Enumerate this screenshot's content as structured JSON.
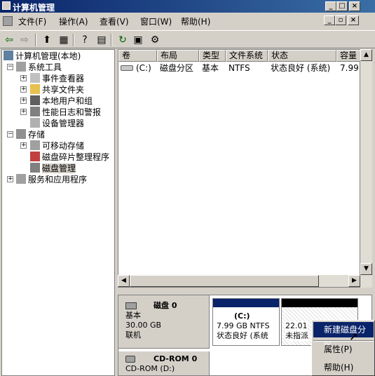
{
  "window": {
    "title": "计算机管理"
  },
  "menu": [
    {
      "label": "文件(F)"
    },
    {
      "label": "操作(A)"
    },
    {
      "label": "查看(V)"
    },
    {
      "label": "窗口(W)"
    },
    {
      "label": "帮助(H)"
    }
  ],
  "tree": {
    "root": "计算机管理(本地)",
    "system_tools": "系统工具",
    "event_viewer": "事件查看器",
    "shared_folders": "共享文件夹",
    "local_users": "本地用户和组",
    "perf_logs": "性能日志和警报",
    "device_manager": "设备管理器",
    "storage": "存储",
    "removable": "可移动存储",
    "defrag": "磁盘碎片整理程序",
    "disk_mgmt": "磁盘管理",
    "services": "服务和应用程序"
  },
  "table": {
    "headers": [
      "卷",
      "布局",
      "类型",
      "文件系统",
      "状态",
      "容量"
    ],
    "row": [
      "(C:)",
      "磁盘分区",
      "基本",
      "NTFS",
      "状态良好 (系统)",
      "7.99"
    ]
  },
  "disk0": {
    "name": "磁盘 0",
    "type": "基本",
    "size": "30.00 GB",
    "status": "联机",
    "part_label": "(C:)",
    "part_size": "7.99 GB NTFS",
    "part_status": "状态良好 (系统",
    "unalloc_size": "22.01",
    "unalloc_status": "未指派"
  },
  "cdrom": {
    "name": "CD-ROM 0",
    "sub": "CD-ROM (D:)"
  },
  "context_menu": {
    "new_partition": "新建磁盘分区",
    "properties": "属性(P)",
    "help": "帮助(H)"
  },
  "colors": {
    "title_bar": "#0a246a",
    "partition_bar": "#0a246a",
    "selection": "#0a246a"
  }
}
